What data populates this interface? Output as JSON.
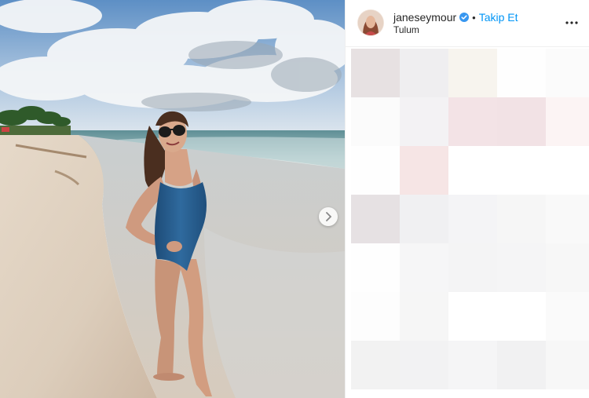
{
  "post": {
    "username": "janeseymour",
    "separator": "•",
    "follow_label": "Takip Et",
    "location": "Tulum",
    "next_icon": "chevron-right-icon",
    "more_icon": "more-horizontal-icon",
    "verified_icon": "verified-badge-icon",
    "colors": {
      "accent": "#0095f6",
      "text": "#262626",
      "verified": "#3897f0"
    }
  },
  "blur_tiles": [
    "#e7e1e2",
    "#efeef0",
    "#f7f4ee",
    "#fefefe",
    "#fbfbfb",
    "#fbfbfb",
    "#f3f2f4",
    "#f3e3e6",
    "#f2e2e5",
    "#fcf4f4",
    "#fefefe",
    "#f6e5e5",
    "#ffffff",
    "#ffffff",
    "#ffffff",
    "#e6e1e3",
    "#f0f0f2",
    "#f4f4f6",
    "#f6f6f6",
    "#f9f9f9",
    "#fefefe",
    "#f6f6f7",
    "#f4f4f5",
    "#f5f5f6",
    "#f7f7f7",
    "#fdfdfd",
    "#f6f6f6",
    "#ffffff",
    "#ffffff",
    "#fafafa",
    "#f2f2f2",
    "#f2f2f3",
    "#f5f5f6",
    "#f1f1f2",
    "#f7f7f7"
  ]
}
